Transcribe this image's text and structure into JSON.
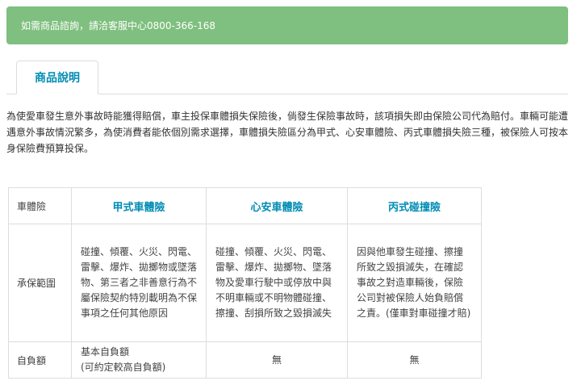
{
  "notice": {
    "text": "如需商品諮詢，請洽客服中心0800-366-168"
  },
  "tabs": [
    {
      "label": "商品說明"
    }
  ],
  "description": "為使愛車發生意外事故時能獲得賠償，車主投保車體損失保險後，倘發生保險事故時，該項損失即由保險公司代為賠付。車輛可能遭遇意外事故情況繁多，為使消費者能依個別需求選擇，車體損失險區分為甲式、心安車體險、丙式車體損失險三種，被保險人可按本身保險費預算投保。",
  "table": {
    "corner": "車體險",
    "columns": [
      "甲式車體險",
      "心安車體險",
      "丙式碰撞險"
    ],
    "rows": [
      {
        "label": "承保範圍",
        "cells": [
          "碰撞、傾覆、火災、閃電、雷擊、爆炸、拋擲物或墜落物、第三者之非善意行為不屬保險契約特別載明為不保事項之任何其他原因",
          "碰撞、傾覆、火災、閃電、雷擊、爆炸、拋擲物、墜落物及愛車行駛中或停放中與不明車輛或不明物體碰撞、擦撞、刮損所致之毀損滅失",
          "因與他車發生碰撞、擦撞所致之毀損滅失，在確認事故之對造車輛後，保險公司對被保險人始負賠償之責。(僅車對車碰撞才賠)"
        ]
      },
      {
        "label": "自負額",
        "cells": [
          "基本自負額\n(可約定較高自負額)",
          "無",
          "無"
        ]
      }
    ]
  }
}
